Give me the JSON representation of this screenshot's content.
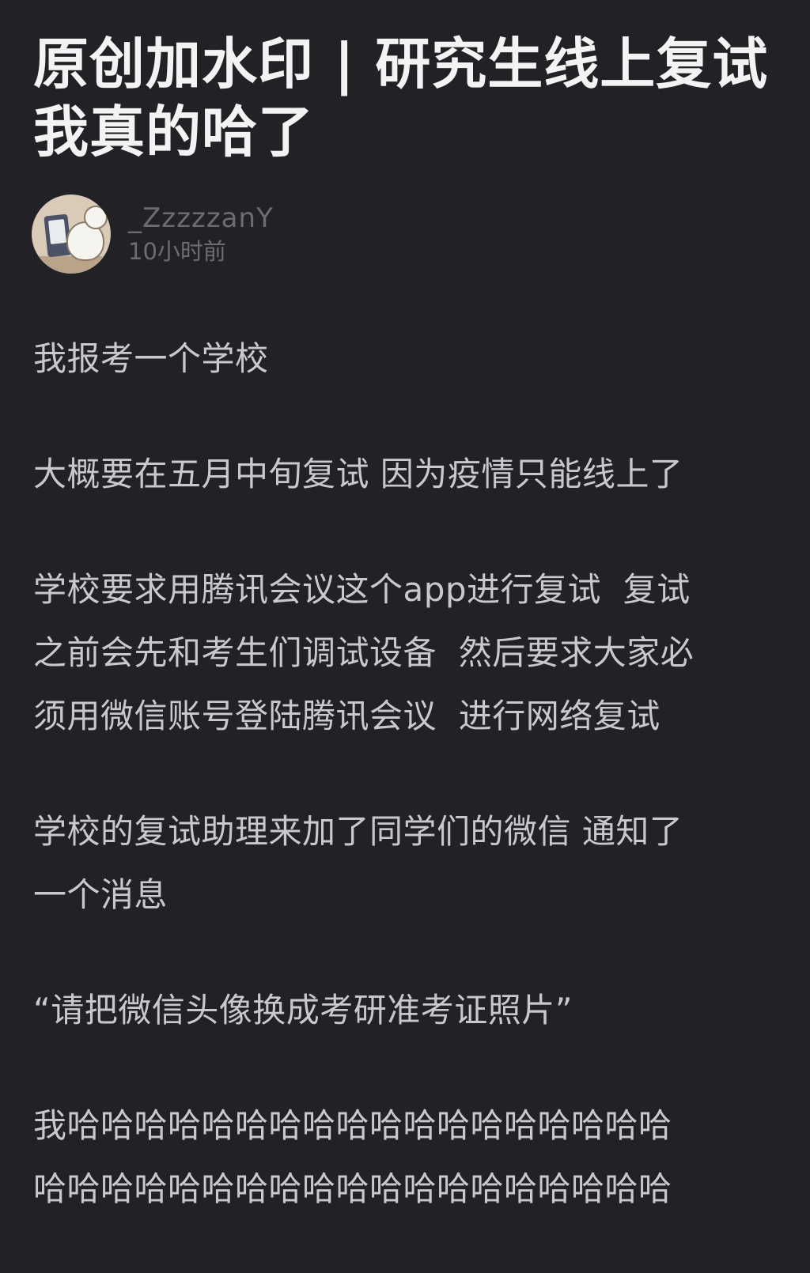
{
  "post": {
    "title": "原创加水印 | 研究生线上复试\n我真的哈了",
    "author": {
      "username": "_ZzzzzanY",
      "timestamp": "10小时前"
    },
    "paragraphs": [
      "我报考一个学校",
      "大概要在五月中旬复试 因为疫情只能线上了",
      "学校要求用腾讯会议这个app进行复试  复试\n之前会先和考生们调试设备  然后要求大家必\n须用微信账号登陆腾讯会议  进行网络复试",
      "学校的复试助理来加了同学们的微信 通知了\n一个消息",
      "“请把微信头像换成考研准考证照片”",
      "我哈哈哈哈哈哈哈哈哈哈哈哈哈哈哈哈哈哈\n哈哈哈哈哈哈哈哈哈哈哈哈哈哈哈哈哈哈哈"
    ]
  }
}
